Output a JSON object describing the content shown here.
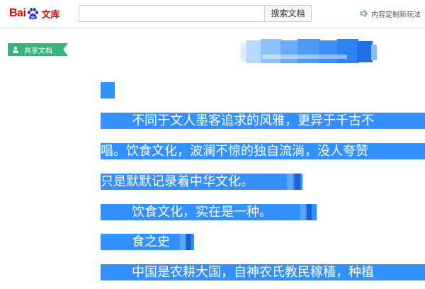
{
  "header": {
    "logo": {
      "bai": "Bai",
      "du_mark": "du",
      "product": "文库"
    },
    "search": {
      "value": "",
      "placeholder": ""
    },
    "search_button": "搜索文档",
    "feedback_link": "内容定制新玩法"
  },
  "tag": {
    "label": "共享文档"
  },
  "document": {
    "title": "",
    "paragraphs": [
      "",
      "不同于文人墨客追求的风雅，更异于千古不",
      "唱。饮食文化，波澜不惊的独自流淌，没人夸赞",
      "只是默默记录着中华文化。",
      "饮食文化，实在是一种。",
      "食之史",
      "中国是农耕大国，自神农氏教民稼穑，种植"
    ]
  },
  "colors": {
    "selection": "#3390ff",
    "selection_dark": "#1f5fd6",
    "logo_red": "#e10602",
    "logo_blue": "#2932e1",
    "tag_green": "#35b57c"
  },
  "icons": [
    "baidu-paw-icon",
    "speaker-icon",
    "user-icon"
  ]
}
